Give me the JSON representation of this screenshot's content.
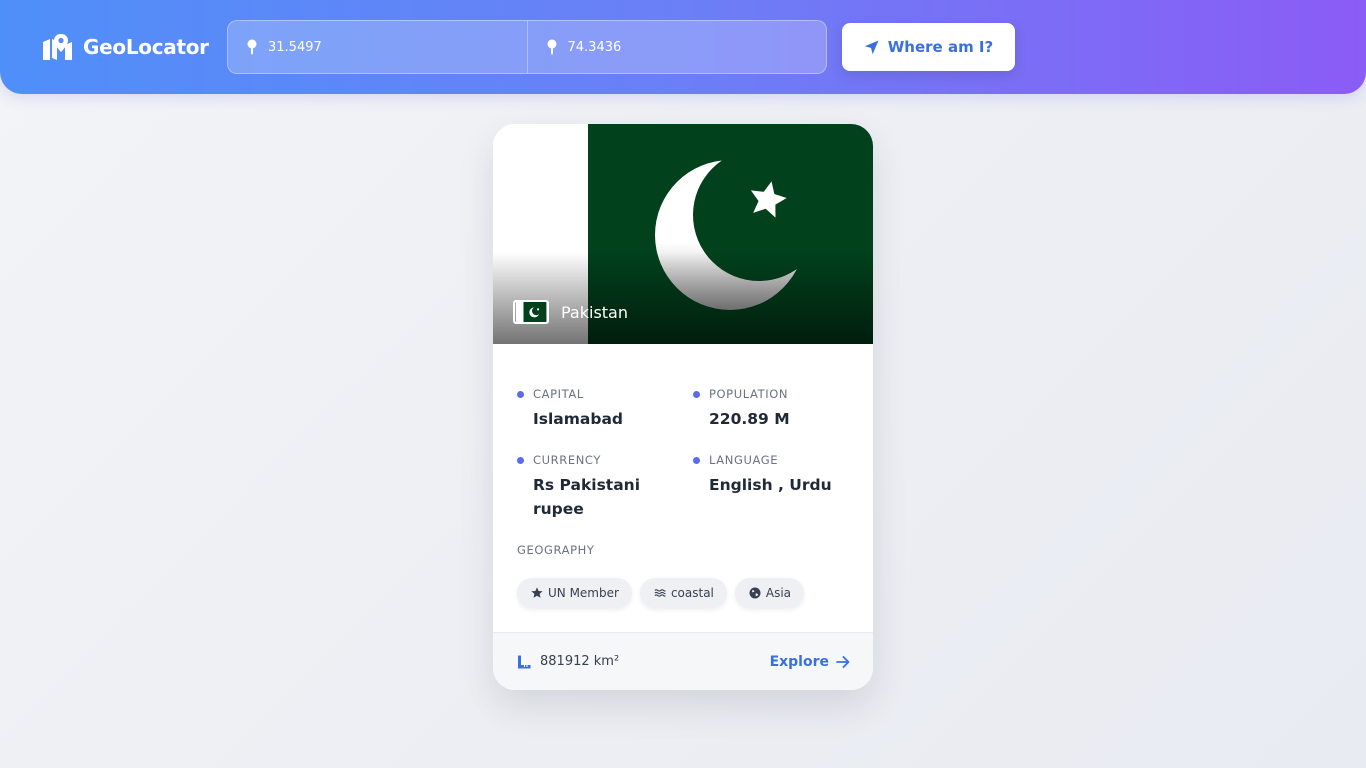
{
  "app": {
    "name": "GeoLocator"
  },
  "search": {
    "latitude": "31.5497",
    "longitude": "74.3436",
    "locate_label": "Where am I?"
  },
  "country": {
    "name": "Pakistan",
    "flag": {
      "hoist_color": "#ffffff",
      "field_color": "#01411c",
      "emblem": "crescent-and-star"
    },
    "fields": [
      {
        "label": "CAPITAL",
        "value": "Islamabad"
      },
      {
        "label": "POPULATION",
        "value": "220.89 M"
      },
      {
        "label": "CURRENCY",
        "value": "Rs Pakistani rupee"
      },
      {
        "label": "LANGUAGE",
        "value": "English , Urdu"
      }
    ],
    "geography_label": "GEOGRAPHY",
    "tags": [
      {
        "label": "UN Member",
        "icon": "star-icon"
      },
      {
        "label": "coastal",
        "icon": "water-icon"
      },
      {
        "label": "Asia",
        "icon": "globe-icon"
      }
    ],
    "area": "881912 km²",
    "explore_label": "Explore"
  },
  "colors": {
    "header_gradient_start": "#4f8ff9",
    "header_gradient_end": "#8b5cf6",
    "accent": "#3b6fe0",
    "bullet": "#5b6bea"
  }
}
